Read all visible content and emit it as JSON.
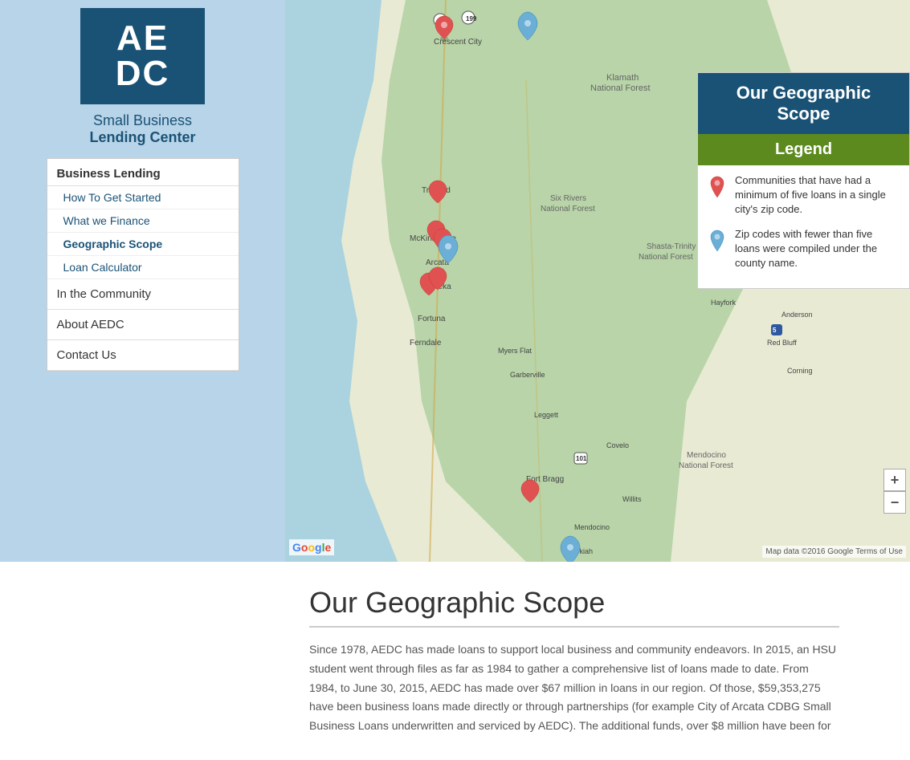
{
  "logo": {
    "letters_line1": "AE",
    "letters_line2": "DC",
    "org_line1": "Small Business",
    "org_line2": "Lending Center"
  },
  "nav": {
    "section_title": "Business Lending",
    "sub_items": [
      {
        "label": "How To Get Started",
        "active": false
      },
      {
        "label": "What we Finance",
        "active": false
      },
      {
        "label": "Geographic Scope",
        "active": true
      },
      {
        "label": "Loan Calculator",
        "active": false
      }
    ],
    "top_items": [
      {
        "label": "In the Community"
      },
      {
        "label": "About AEDC"
      },
      {
        "label": "Contact Us"
      }
    ]
  },
  "map": {
    "title": "Our Geographic Scope",
    "legend_title": "Our Geographic Scope",
    "legend_subtitle": "Legend",
    "legend_items": [
      {
        "pin_type": "red",
        "text": "Communities that have had a minimum of five loans in a single city's zip code."
      },
      {
        "pin_type": "blue",
        "text": "Zip codes with fewer than five loans were compiled under the county name."
      }
    ],
    "zoom_in": "+",
    "zoom_out": "−",
    "attribution": "Map data ©2016 Google   Terms of Use",
    "google_logo": "Google"
  },
  "content": {
    "title": "Our Geographic Scope",
    "body": "Since 1978, AEDC has made loans to support local business and community endeavors. In 2015, an HSU student went through files as far as 1984 to gather a comprehensive list of loans made to date. From 1984, to June 30, 2015, AEDC has made over $67 million in loans in our region. Of those, $59,353,275 have been business loans made directly or through partnerships (for example City of Arcata CDBG Small Business Loans underwritten and serviced by AEDC). The additional funds, over $8 million have been for"
  }
}
